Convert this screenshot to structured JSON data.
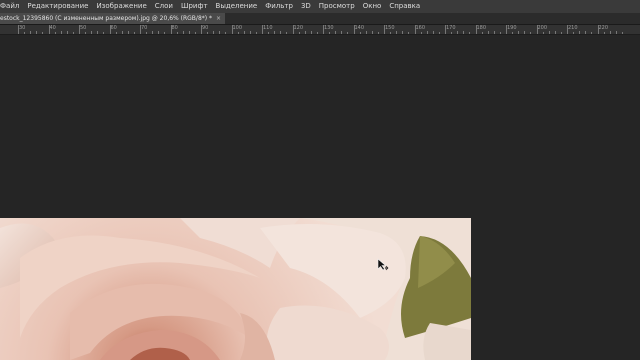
{
  "menubar": {
    "items": [
      "Файл",
      "Редактирование",
      "Изображение",
      "Слои",
      "Шрифт",
      "Выделение",
      "Фильтр",
      "3D",
      "Просмотр",
      "Окно",
      "Справка"
    ]
  },
  "document_tab": {
    "title": "estock_12395860 (С измененным размером).jpg @ 20,6% (RGB/8*) *",
    "close_label": "×"
  },
  "ruler": {
    "labels": [
      "30",
      "40",
      "50",
      "60",
      "70",
      "80",
      "90",
      "100",
      "110",
      "120",
      "130",
      "140",
      "150",
      "160",
      "170",
      "180",
      "190",
      "200",
      "210",
      "220"
    ]
  },
  "icons": {
    "cursor": "move-cursor-icon",
    "close": "close-icon"
  },
  "colors": {
    "menubar_bg": "#3a3a3a",
    "canvas_bg": "#252525",
    "rose_light": "#efd4c9",
    "rose_deep": "#d99a86",
    "leaf": "#7a7a3a"
  }
}
